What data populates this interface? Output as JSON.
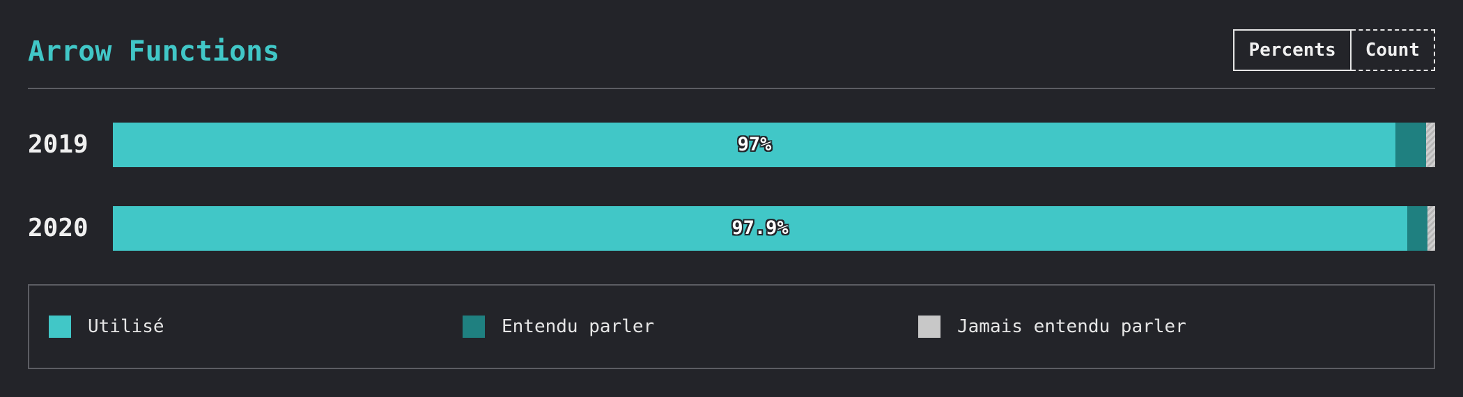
{
  "title": "Arrow Functions",
  "toggle": {
    "percents_label": "Percents",
    "count_label": "Count"
  },
  "colors": {
    "accent": "#41c7c7",
    "used": "#41c7c7",
    "heard": "#1f8080",
    "never": "#c8c8c8",
    "background": "#232429"
  },
  "legend": [
    {
      "label": "Utilisé",
      "color": "#41c7c7"
    },
    {
      "label": "Entendu parler",
      "color": "#1f8080"
    },
    {
      "label": "Jamais entendu parler",
      "color": "#c8c8c8"
    }
  ],
  "chart_data": {
    "type": "bar",
    "orientation": "horizontal",
    "stacked": true,
    "categories": [
      "2019",
      "2020"
    ],
    "series": [
      {
        "name": "Utilisé",
        "values": [
          97.0,
          97.9
        ]
      },
      {
        "name": "Entendu parler",
        "values": [
          2.3,
          1.5
        ]
      },
      {
        "name": "Jamais entendu parler",
        "values": [
          0.7,
          0.6
        ]
      }
    ],
    "data_labels": [
      "97%",
      "97.9%"
    ],
    "xlim": [
      0,
      100
    ],
    "legend_position": "bottom"
  }
}
